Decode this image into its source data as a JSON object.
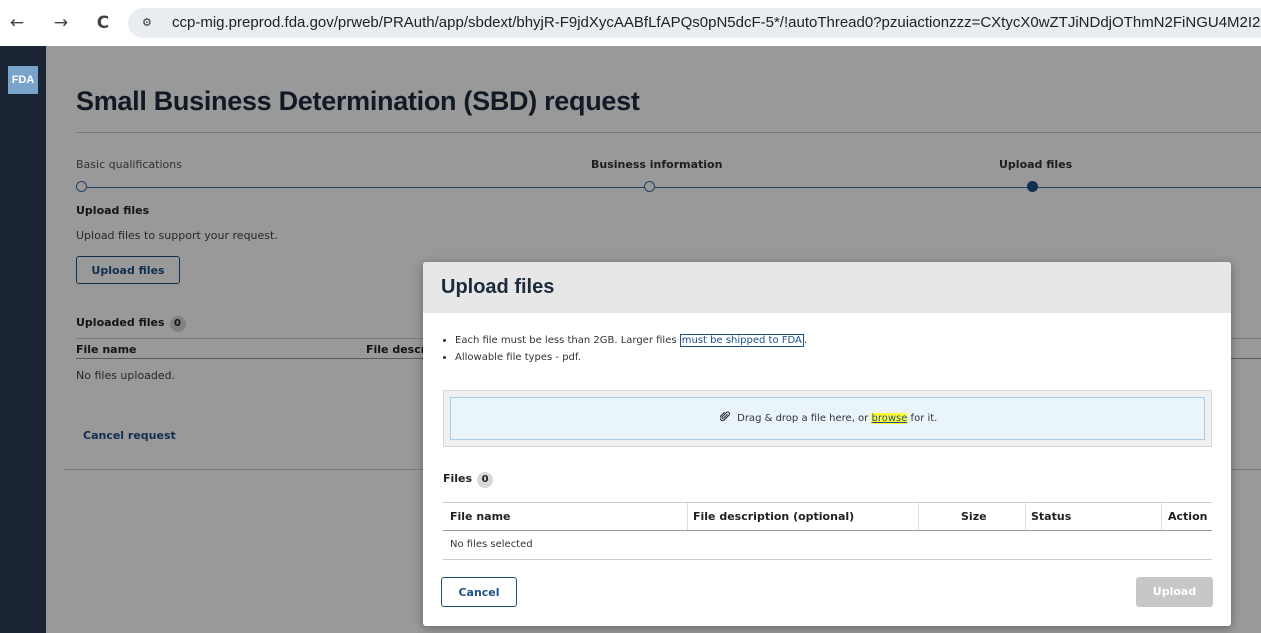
{
  "browser": {
    "back_icon": "←",
    "forward_icon": "→",
    "reload_icon": "C",
    "site_info_icon": "⚙",
    "url": "ccp-mig.preprod.fda.gov/prweb/PRAuth/app/sbdext/bhyjR-F9jdXycAABfLfAPQs0pN5dcF-5*/!autoThread0?pzuiactionzzz=CXtycX0wZTJiNDdjOThmN2FiNGU4M2I2("
  },
  "sidebar": {
    "logo_text": "FDA"
  },
  "page": {
    "title": "Small Business Determination (SBD) request",
    "steps": [
      {
        "label": "Basic qualifications",
        "state": "complete"
      },
      {
        "label": "Business information",
        "state": "complete"
      },
      {
        "label": "Upload files",
        "state": "current"
      }
    ],
    "section_heading": "Upload files",
    "section_description": "Upload files to support your request.",
    "upload_button": "Upload files",
    "uploaded_files_label": "Uploaded files",
    "uploaded_files_count": "0",
    "table_headers": {
      "file_name": "File name",
      "file_description": "File descr"
    },
    "no_files": "No files uploaded.",
    "cancel_request": "Cancel request"
  },
  "modal": {
    "title": "Upload files",
    "bullet1_prefix": "Each file must be less than 2GB. Larger files ",
    "bullet1_link": "must be shipped to FDA",
    "bullet1_suffix": ".",
    "bullet2": "Allowable file types - pdf.",
    "dropzone": {
      "icon": "paperclip-icon",
      "text_before": "Drag & drop a file here, or ",
      "browse_link": "browse",
      "text_after": " for it.",
      "highlight_color": "#ffff33"
    },
    "files_label": "Files",
    "files_count": "0",
    "table_headers": {
      "file_name": "File name",
      "file_description": "File description (optional)",
      "size": "Size",
      "status": "Status",
      "action": "Action"
    },
    "no_files": "No files selected",
    "cancel_button": "Cancel",
    "upload_button": "Upload"
  },
  "colors": {
    "accent": "#1e4f86",
    "sidebar": "#1a2433",
    "modal_header": "#e7e7e7",
    "disabled_button": "#c7c7c7"
  }
}
